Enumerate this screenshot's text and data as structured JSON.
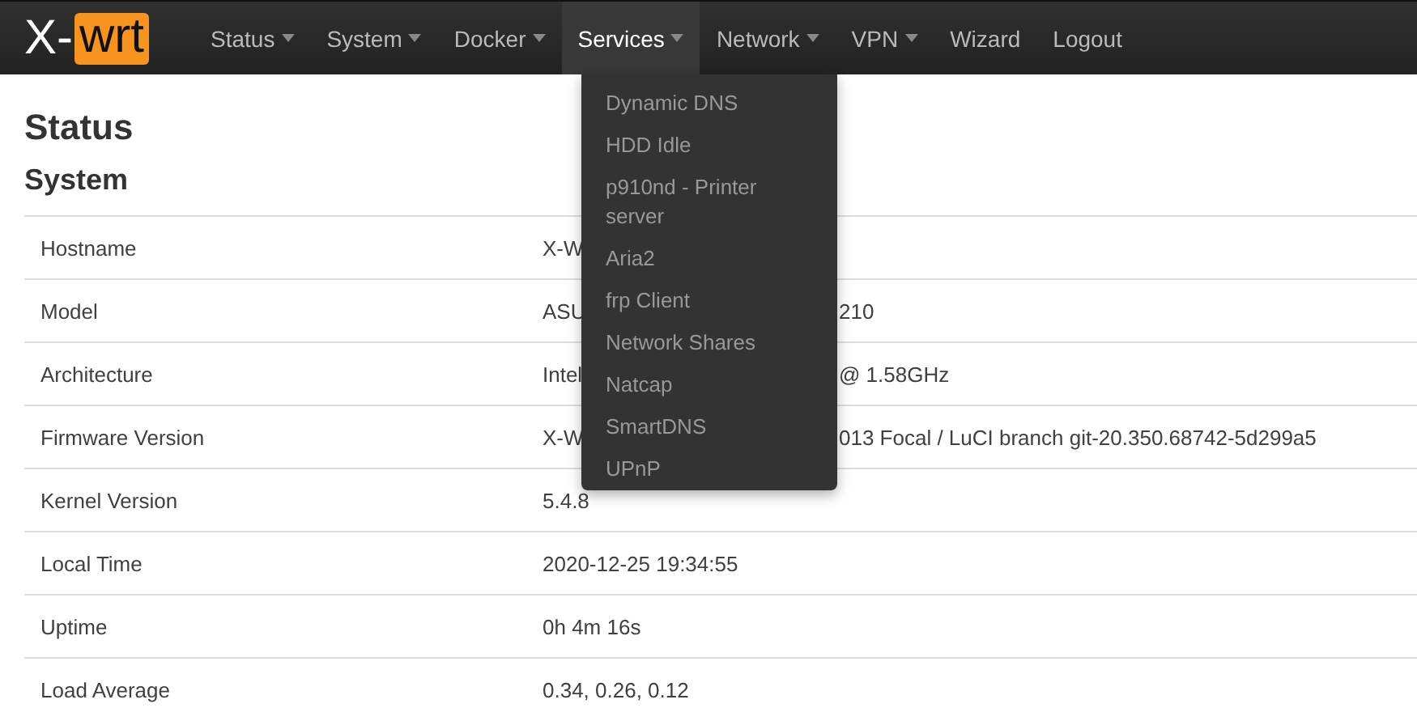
{
  "brand": {
    "left": "X-",
    "right": "wrt"
  },
  "nav": [
    {
      "label": "Status",
      "dropdown": true,
      "selected": false
    },
    {
      "label": "System",
      "dropdown": true,
      "selected": false
    },
    {
      "label": "Docker",
      "dropdown": true,
      "selected": false
    },
    {
      "label": "Services",
      "dropdown": true,
      "selected": true
    },
    {
      "label": "Network",
      "dropdown": true,
      "selected": false
    },
    {
      "label": "VPN",
      "dropdown": true,
      "selected": false
    },
    {
      "label": "Wizard",
      "dropdown": false,
      "selected": false
    },
    {
      "label": "Logout",
      "dropdown": false,
      "selected": false
    }
  ],
  "services_menu": [
    "Dynamic DNS",
    "HDD Idle",
    "p910nd - Printer server",
    "Aria2",
    "frp Client",
    "Network Shares",
    "Natcap",
    "SmartDNS",
    "UPnP"
  ],
  "title": "Status",
  "section": "System",
  "rows": [
    {
      "label": "Hostname",
      "value_parts": [
        "X-W"
      ]
    },
    {
      "label": "Model",
      "value_parts": [
        "ASU",
        "210"
      ]
    },
    {
      "label": "Architecture",
      "value_parts": [
        "Intel",
        "@ 1.58GHz"
      ]
    },
    {
      "label": "Firmware Version",
      "value_parts": [
        "X-W",
        "013 Focal / LuCI branch git-20.350.68742-5d299a5"
      ]
    },
    {
      "label": "Kernel Version",
      "value_parts": [
        "5.4.8"
      ]
    },
    {
      "label": "Local Time",
      "value_parts": [
        "2020-12-25 19:34:55"
      ]
    },
    {
      "label": "Uptime",
      "value_parts": [
        "0h 4m 16s"
      ]
    },
    {
      "label": "Load Average",
      "value_parts": [
        "0.34, 0.26, 0.12"
      ]
    }
  ]
}
